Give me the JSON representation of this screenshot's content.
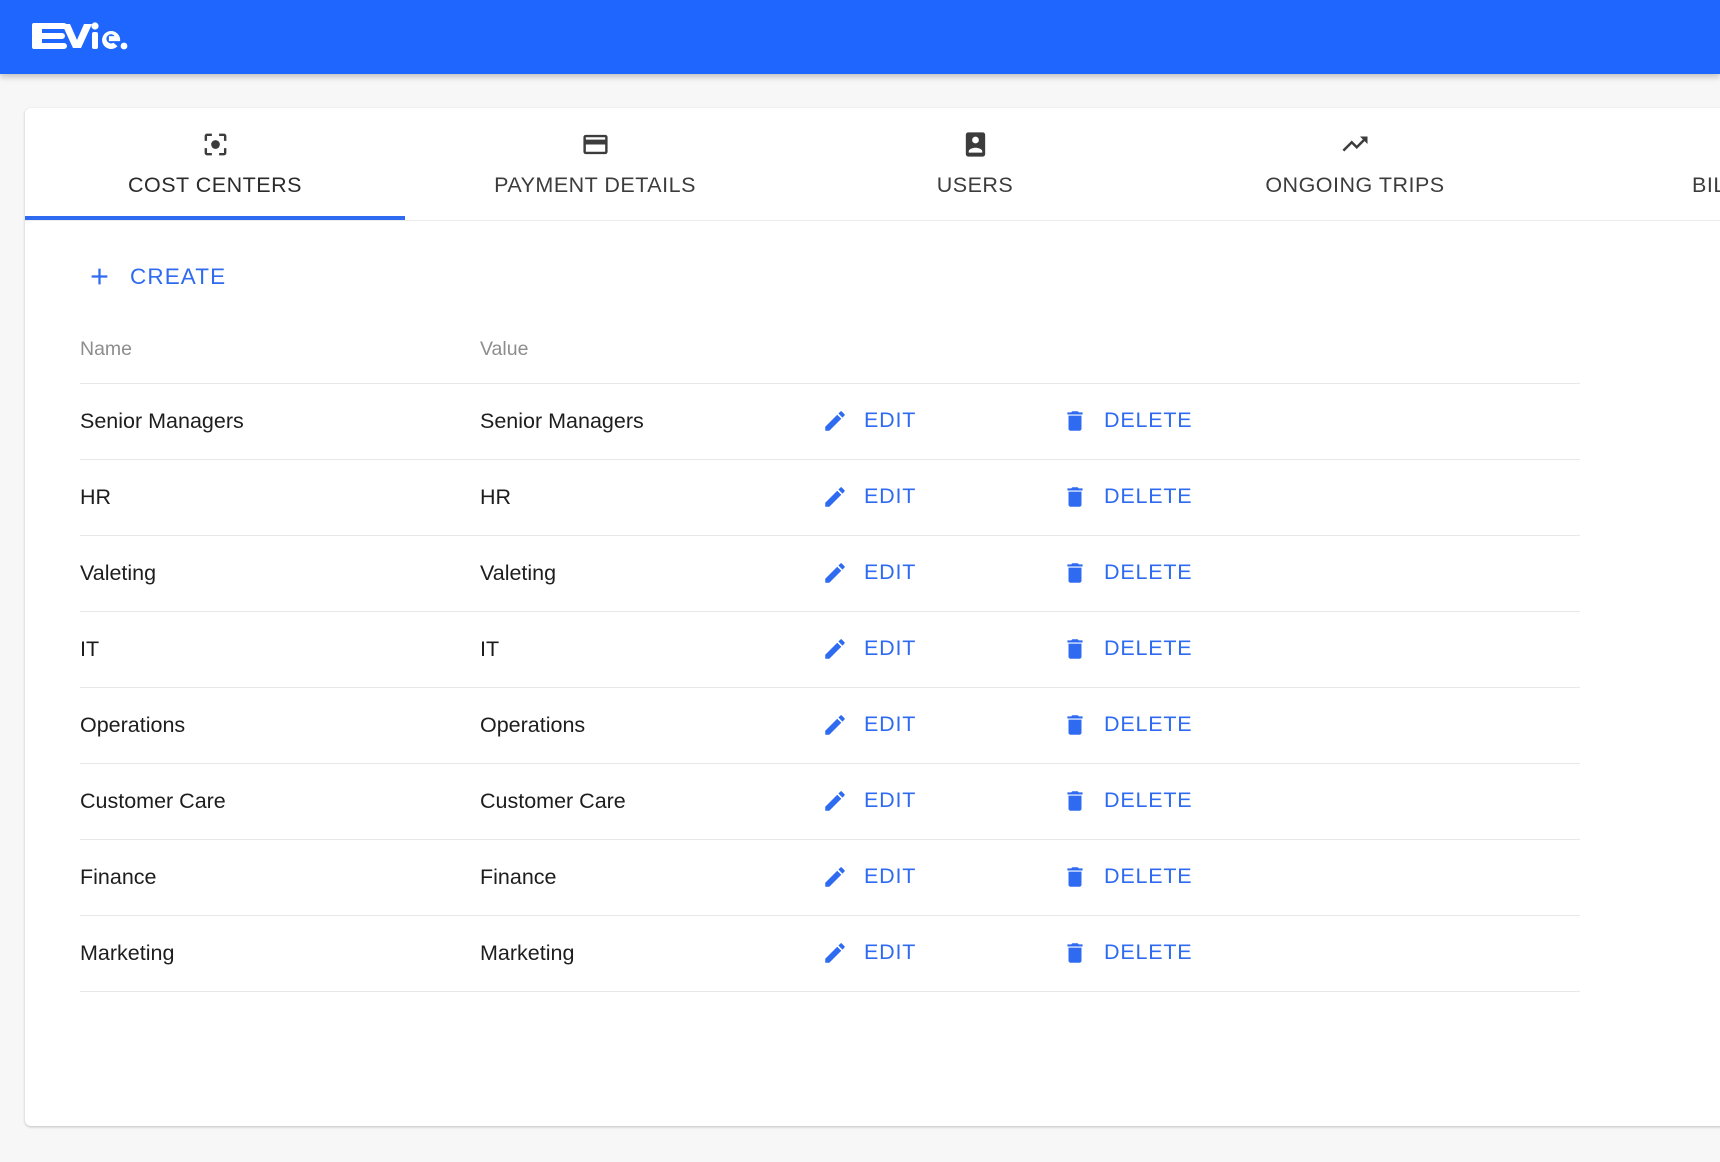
{
  "brand": {
    "name": "EVie",
    "bar_color": "#1F66FF"
  },
  "accent_color": "#2F6BF0",
  "tabs": [
    {
      "label": "COST CENTERS",
      "icon": "center-focus-icon",
      "active": true
    },
    {
      "label": "PAYMENT DETAILS",
      "icon": "credit-card-icon",
      "active": false
    },
    {
      "label": "USERS",
      "icon": "person-badge-icon",
      "active": false
    },
    {
      "label": "ONGOING TRIPS",
      "icon": "trending-up-icon",
      "active": false
    },
    {
      "label": "BILLING",
      "icon": "receipt-icon",
      "active": false
    }
  ],
  "toolbar": {
    "create_label": "CREATE",
    "create_icon": "plus-icon"
  },
  "table": {
    "columns": [
      "Name",
      "Value",
      "",
      ""
    ],
    "edit_label": "EDIT",
    "delete_label": "DELETE",
    "edit_icon": "pencil-icon",
    "delete_icon": "trash-icon",
    "rows": [
      {
        "name": "Senior Managers",
        "value": "Senior Managers"
      },
      {
        "name": "HR",
        "value": "HR"
      },
      {
        "name": "Valeting",
        "value": "Valeting"
      },
      {
        "name": "IT",
        "value": "IT"
      },
      {
        "name": "Operations",
        "value": "Operations"
      },
      {
        "name": "Customer Care",
        "value": "Customer Care"
      },
      {
        "name": "Finance",
        "value": "Finance"
      },
      {
        "name": "Marketing",
        "value": "Marketing"
      }
    ]
  }
}
